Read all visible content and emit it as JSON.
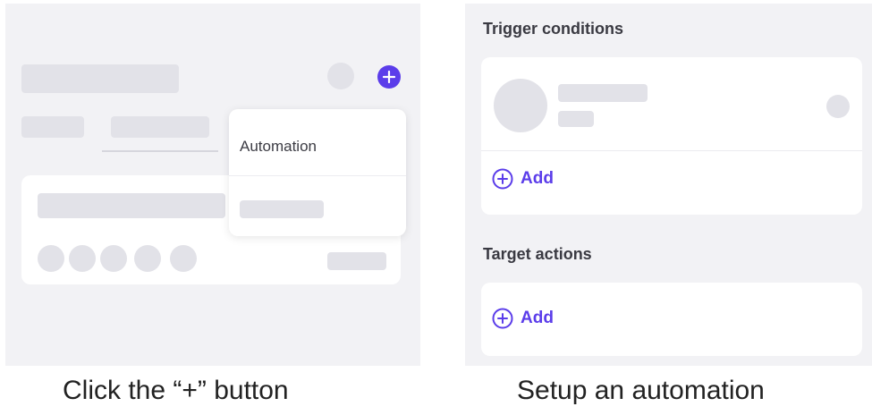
{
  "left": {
    "menu": {
      "automation_label": "Automation"
    },
    "caption": "Click the “+” button",
    "plus_symbol": "+"
  },
  "right": {
    "trigger": {
      "heading": "Trigger conditions",
      "add_label": "Add"
    },
    "target": {
      "heading": "Target actions",
      "add_label": "Add"
    },
    "caption": "Setup an automation"
  },
  "colors": {
    "accent": "#5b3dea",
    "panel_bg": "#f2f2f5",
    "placeholder": "#e2e2e8"
  },
  "icons": [
    "plus-icon",
    "add-circle-icon"
  ]
}
